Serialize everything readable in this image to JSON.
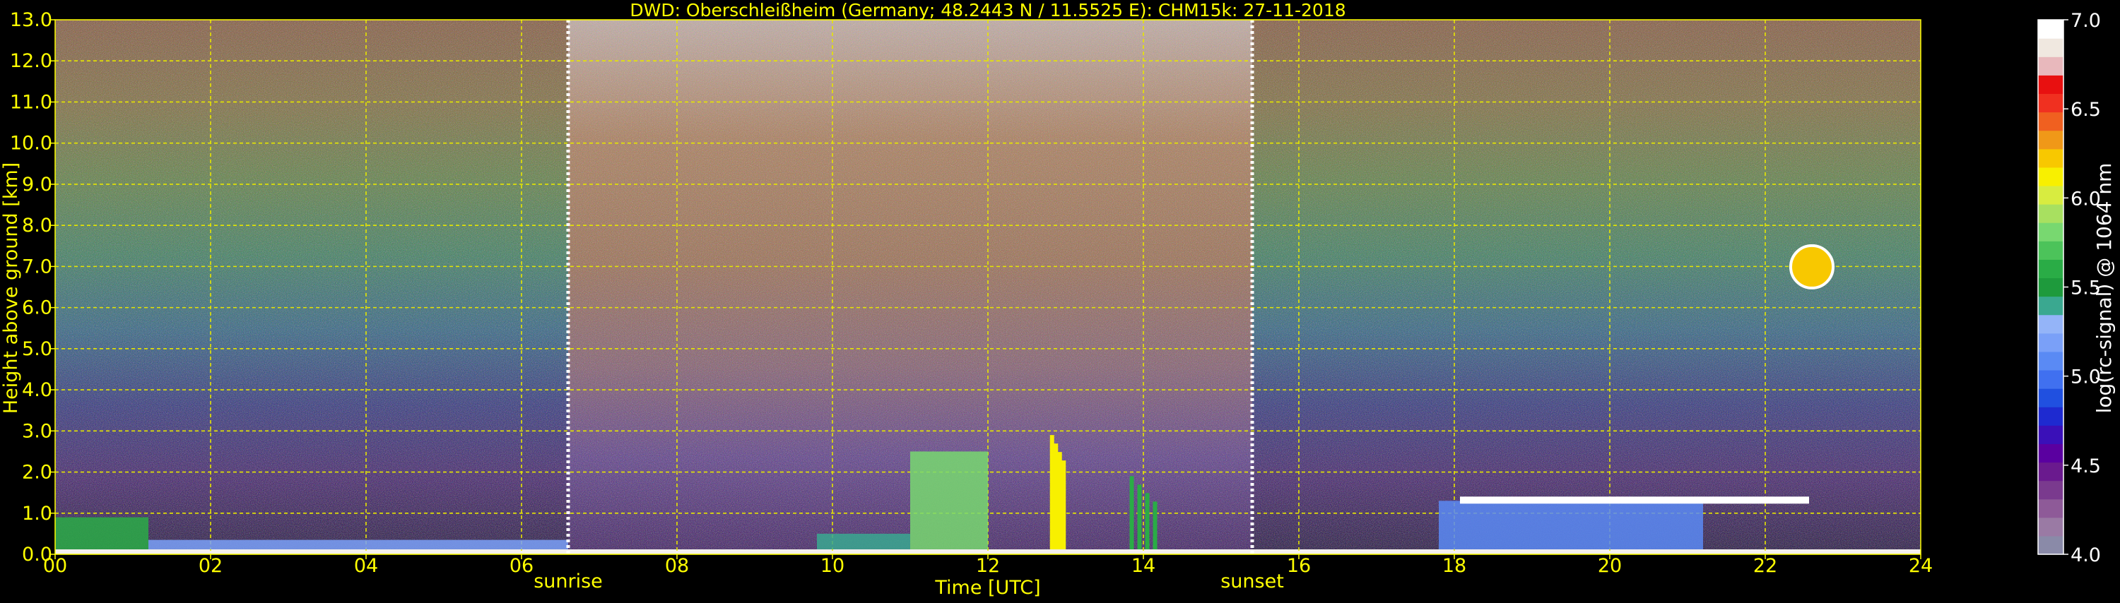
{
  "chart_data": {
    "type": "heatmap",
    "title": "DWD: Oberschleißheim (Germany; 48.2443 N / 11.5525 E):    CHM15k: 27-11-2018",
    "xlabel": "Time [UTC]",
    "ylabel": "Height above ground [km]",
    "xlim": [
      0,
      24
    ],
    "ylim": [
      0.0,
      13.0
    ],
    "x_ticks": [
      "00",
      "02",
      "04",
      "06",
      "08",
      "10",
      "12",
      "14",
      "16",
      "18",
      "20",
      "22",
      "24"
    ],
    "y_ticks": [
      "0.0",
      "1.0",
      "2.0",
      "3.0",
      "4.0",
      "5.0",
      "6.0",
      "7.0",
      "8.0",
      "9.0",
      "10.0",
      "11.0",
      "12.0",
      "13.0"
    ],
    "grid": true,
    "events": [
      {
        "label": "sunrise",
        "time": 6.6
      },
      {
        "label": "sunset",
        "time": 15.4
      }
    ],
    "colorbar": {
      "label": "log(rc-signal) @ 1064 nm",
      "min": 4.0,
      "max": 7.0,
      "ticks": [
        "4.0",
        "4.5",
        "5.0",
        "5.5",
        "6.0",
        "6.5",
        "7.0"
      ],
      "colors": [
        "#8a8aa8",
        "#9a7aa4",
        "#8e5a98",
        "#7a3a8e",
        "#6a1a8e",
        "#5a00a0",
        "#3a10b8",
        "#1e2ad0",
        "#2050e0",
        "#4070f0",
        "#5a8af4",
        "#7aa0f8",
        "#94b4f8",
        "#3aa890",
        "#1e9a3c",
        "#2aac46",
        "#4cc35a",
        "#78d870",
        "#a8e060",
        "#d8ec40",
        "#f8f000",
        "#f8c800",
        "#f09818",
        "#f06020",
        "#f03020",
        "#e81010",
        "#e8b8bc",
        "#f0e8e0",
        "#ffffff"
      ]
    },
    "series": [
      {
        "values": [
          {
            "start": 0.0,
            "end": 1.2,
            "top": 0.9,
            "level": 5.6
          },
          {
            "start": 1.2,
            "end": 6.6,
            "top": 0.35,
            "level": 5.2
          },
          {
            "start": 9.8,
            "end": 11.0,
            "top": 0.5,
            "level": 5.4
          },
          {
            "start": 11.0,
            "end": 12.0,
            "top": 2.5,
            "level": 5.8
          },
          {
            "start": 12.8,
            "end": 13.0,
            "top": 2.9,
            "level": 6.1
          },
          {
            "start": 13.8,
            "end": 14.2,
            "top": 1.9,
            "level": 5.6
          },
          {
            "start": 17.8,
            "end": 21.2,
            "top": 1.3,
            "level": 5.1
          },
          {
            "start": 22.4,
            "end": 22.8,
            "top": 7.3,
            "level": 6.2
          }
        ]
      }
    ]
  }
}
